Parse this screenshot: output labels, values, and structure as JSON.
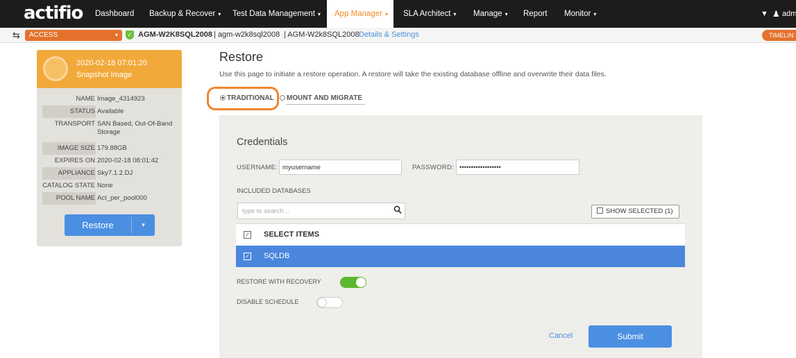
{
  "app": {
    "logo": "actifio"
  },
  "nav": {
    "items": [
      {
        "label": "Dashboard",
        "chevron": ""
      },
      {
        "label": "Backup & Recover",
        "chevron": "▾"
      },
      {
        "label": "Test Data Management",
        "chevron": "▾"
      },
      {
        "label": "App Manager",
        "chevron": "▾"
      },
      {
        "label": "SLA Architect",
        "chevron": "▾"
      },
      {
        "label": "Manage",
        "chevron": "▾"
      },
      {
        "label": "Report",
        "chevron": ""
      },
      {
        "label": "Monitor",
        "chevron": "▾"
      }
    ],
    "active": "App Manager",
    "filter_icon": "▼",
    "user_icon": "♟",
    "user_label": "adm"
  },
  "subbar": {
    "back_icon": "⇆",
    "access_label": "ACCESS",
    "access_chevron": "▾",
    "shield_icon": "✓",
    "app_name": "AGM-W2K8SQL2008",
    "host_lower": "| agm-w2k8sql2008",
    "host_mixed": "| AGM-W2k8SQL2008",
    "details_link": "Details & Settings",
    "timeline": "TIMELIN"
  },
  "snapshot": {
    "date": "2020-02-18  07:01:20",
    "type": "Snapshot Image",
    "props": [
      {
        "key": "NAME",
        "value": "Image_4314923"
      },
      {
        "key": "STATUS",
        "value": "Available"
      },
      {
        "key": "TRANSPORT",
        "value": "SAN Based, Out-Of-Band Storage"
      },
      {
        "key": "IMAGE SIZE",
        "value": "179.88GB"
      },
      {
        "key": "EXPIRES ON",
        "value": "2020-02-18 08:01:42"
      },
      {
        "key": "APPLIANCE",
        "value": "Sky7.1.2.DJ"
      },
      {
        "key": "CATALOG STATE",
        "value": "None"
      },
      {
        "key": "POOL NAME",
        "value": "Act_per_pool000"
      }
    ],
    "restore_button": "Restore",
    "restore_dropdown": "▾"
  },
  "restore": {
    "title": "Restore",
    "description": "Use this page to initiate a restore operation. A restore will take the existing database offline and overwrite their data files.",
    "mode_traditional": "TRADITIONAL",
    "mode_mount": "MOUNT AND MIGRATE",
    "credentials_title": "Credentials",
    "username_label": "USERNAME:",
    "username_value": "myusername",
    "password_label": "PASSWORD:",
    "password_value": "••••••••••••••••••",
    "included_label": "INCLUDED DATABASES",
    "search_placeholder": "type to search...",
    "show_selected": "SHOW SELECTED (1)",
    "select_items": "SELECT ITEMS",
    "databases": [
      "SQLDB"
    ],
    "check_mark": "✓",
    "restore_with_recovery": "RESTORE WITH RECOVERY",
    "disable_schedule": "DISABLE SCHEDULE",
    "cancel": "Cancel",
    "submit": "Submit"
  },
  "colors": {
    "accent": "#f28c28",
    "primary": "#4a8fe2",
    "toggle_on": "#5cb82e",
    "nav_bg": "#1c1c1c"
  }
}
